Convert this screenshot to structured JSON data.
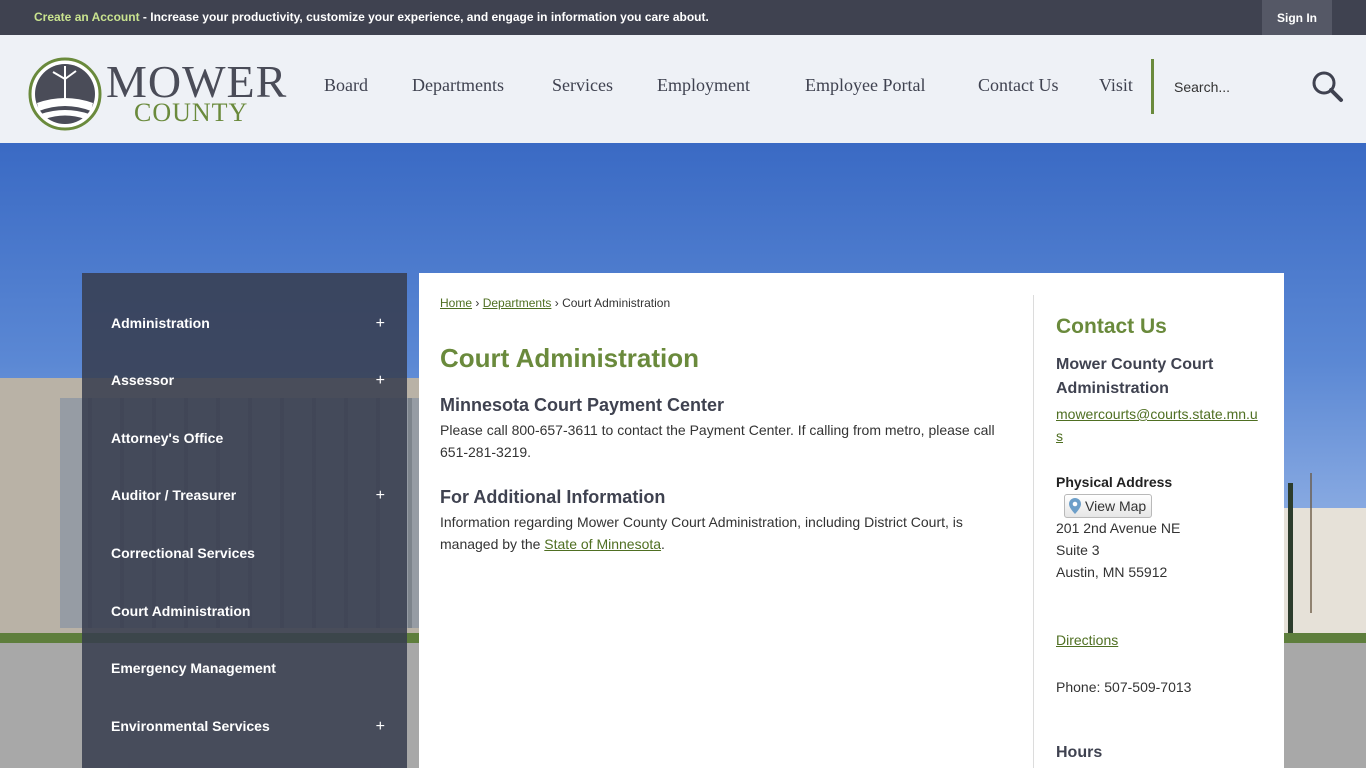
{
  "topbar": {
    "create_account": "Create an Account",
    "message": " - Increase your productivity, customize your experience, and engage in information you care about.",
    "sign_in": "Sign In"
  },
  "logo": {
    "word1": "MOWER",
    "word2": "COUNTY"
  },
  "nav": {
    "items": [
      "Board",
      "Departments",
      "Services",
      "Employment",
      "Employee Portal",
      "Contact Us",
      "Visit"
    ],
    "search_placeholder": "Search..."
  },
  "sidebar": {
    "items": [
      {
        "label": "Administration",
        "expand": "+"
      },
      {
        "label": "Assessor",
        "expand": "+"
      },
      {
        "label": "Attorney's Office",
        "expand": ""
      },
      {
        "label": "Auditor / Treasurer",
        "expand": "+"
      },
      {
        "label": "Correctional Services",
        "expand": ""
      },
      {
        "label": "Court Administration",
        "expand": ""
      },
      {
        "label": "Emergency Management",
        "expand": ""
      },
      {
        "label": "Environmental Services",
        "expand": "+"
      }
    ]
  },
  "breadcrumb": {
    "home": "Home",
    "sep1": "›",
    "departments": "Departments",
    "sep2": "›",
    "current": "Court Administration"
  },
  "main": {
    "title": "Court Administration",
    "section1_title": "Minnesota Court Payment Center",
    "section1_text": "Please call 800-657-3611 to contact the Payment Center. If calling from metro, please call 651-281-3219.",
    "section2_title": "For Additional Information",
    "section2_text": "Information regarding Mower County Court Administration, including District Court, is managed by the ",
    "section2_link": "State of Minnesota",
    "section2_end": "."
  },
  "contact": {
    "title": "Contact Us",
    "org": "Mower County Court Administration",
    "email": "mowercourts@courts.state.mn.us",
    "address_label": "Physical Address",
    "view_map": "View Map",
    "address1": "201 2nd Avenue NE",
    "address2": "Suite 3",
    "address3": "Austin, MN 55912",
    "directions": "Directions",
    "phone": "Phone: 507-509-7013",
    "hours": "Hours"
  },
  "colors": {
    "accent": "#6a8a3c",
    "dark": "#3f4250",
    "link": "#4f6f22"
  }
}
